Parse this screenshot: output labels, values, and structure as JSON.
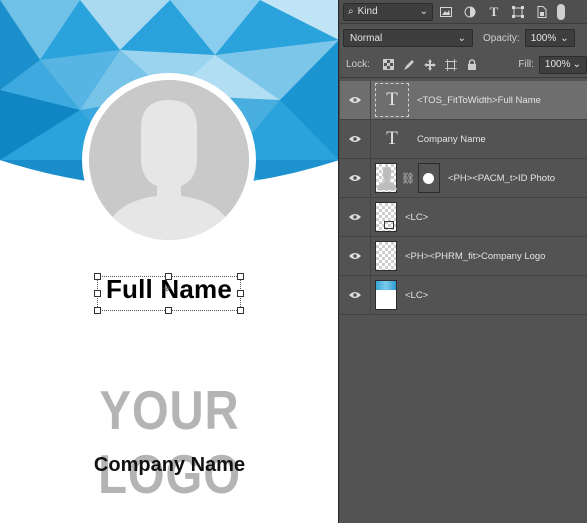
{
  "canvas": {
    "full_name": "Full Name",
    "logo_text": "YOUR LOGO",
    "company_name": "Company Name",
    "colors": {
      "accent_blue": "#1fa0db",
      "logo_gray": "#b4b4b4",
      "photo_gray": "#c9c9c9"
    }
  },
  "layers_panel": {
    "filter": {
      "kind_label": "Kind",
      "icons": [
        "image-filter-icon",
        "adjustment-filter-icon",
        "type-filter-icon",
        "shape-filter-icon",
        "smart-object-filter-icon"
      ]
    },
    "blend_mode": "Normal",
    "opacity_label": "Opacity:",
    "opacity_value": "100%",
    "lock_label": "Lock:",
    "fill_label": "Fill:",
    "fill_value": "100%",
    "layers": [
      {
        "name": "<TOS_FitToWidth>Full Name",
        "type": "text",
        "selected": true
      },
      {
        "name": "Company Name",
        "type": "text",
        "selected": false
      },
      {
        "name": "<PH><PACM_t>ID Photo",
        "type": "masked-image",
        "selected": false
      },
      {
        "name": "<LC>",
        "type": "image",
        "selected": false
      },
      {
        "name": "<PH><PHRM_fit>Company Logo",
        "type": "image",
        "selected": false
      },
      {
        "name": "<LC>",
        "type": "background",
        "selected": false
      }
    ]
  }
}
